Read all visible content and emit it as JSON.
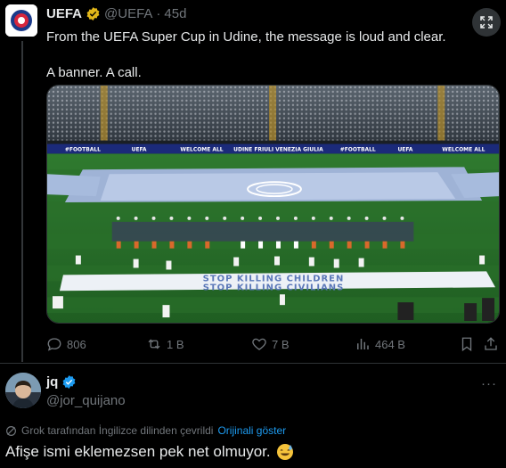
{
  "tweet": {
    "author_name": "UEFA",
    "author_handle": "@UEFA",
    "separator": "·",
    "time": "45d",
    "text_line1": "From the UEFA Super Cup in Udine, the message is loud and clear.",
    "text_line2": "A banner. A call.",
    "media": {
      "ad_board_texts": [
        "#FOOTBALL",
        "UEFA",
        "WELCOME ALL",
        "UDINE FRIULI VENEZIA GIULIA",
        "#FOOTBALL",
        "UEFA",
        "WELCOME ALL"
      ],
      "banner_line1": "STOP KILLING CHILDREN",
      "banner_line2": "STOP KILLING CIVILIANS"
    },
    "actions": {
      "replies": "806",
      "reposts": "1 B",
      "likes": "7 B",
      "views": "464 B"
    }
  },
  "reply": {
    "author_name": "jq",
    "author_handle": "@jor_quijano",
    "more": "···",
    "translation_note": "Grok tarafından İngilizce dilinden çevrildi",
    "show_original": "Orijinali göster",
    "text": "Afişe ismi eklemezsen pek net olmuyor."
  },
  "colors": {
    "background": "#000000",
    "text": "#e7e9ea",
    "muted": "#71767b",
    "link": "#1d9bf0",
    "verified_gold": "#e2b719",
    "verified_blue": "#1d9bf0"
  }
}
